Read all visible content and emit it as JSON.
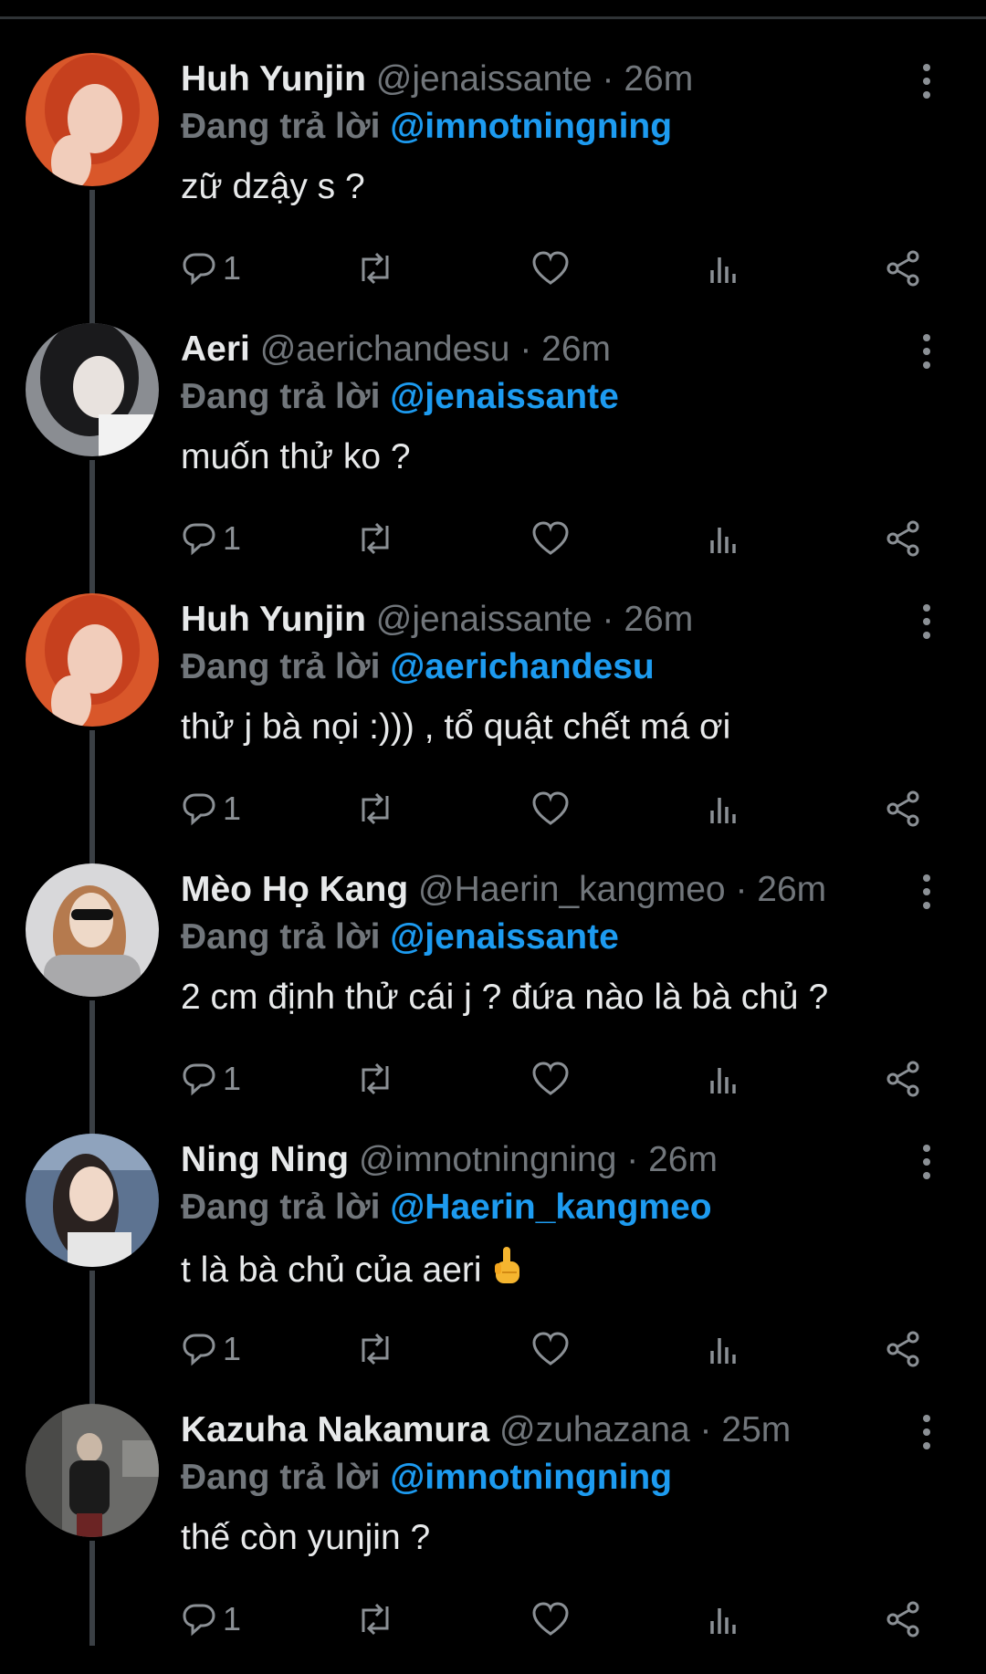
{
  "reply_prefix": "Đang trả lời",
  "tweets": [
    {
      "name": "Huh Yunjin",
      "handle": "@jenaissante · 26m",
      "reply_to": "@imnotningning",
      "text": "zữ dzậy s ?",
      "replies": "1",
      "avatar": {
        "bg": "#d9572a",
        "skin": "#f1cdbb",
        "hair": "#c6401e"
      }
    },
    {
      "name": "Aeri",
      "handle": "@aerichandesu · 26m",
      "reply_to": "@jenaissante",
      "text": "muốn thử ko ?",
      "replies": "1",
      "avatar": {
        "bg": "#8a8d92",
        "skin": "#e8e2de",
        "hair": "#1a1a1c"
      }
    },
    {
      "name": "Huh Yunjin",
      "handle": "@jenaissante · 26m",
      "reply_to": "@aerichandesu",
      "text": "thử j bà nọi :))) , tổ quật chết má ơi",
      "replies": "1",
      "avatar": {
        "bg": "#d9572a",
        "skin": "#f1cdbb",
        "hair": "#c6401e"
      }
    },
    {
      "name": "Mèo Họ Kang",
      "handle": "@Haerin_kangmeo · 26m",
      "reply_to": "@jenaissante",
      "text": "2 cm định thử cái j ? đứa nào là bà chủ ?",
      "replies": "1",
      "avatar": {
        "bg": "#d8d8da",
        "skin": "#eed9c8",
        "hair": "#b57a4e"
      }
    },
    {
      "name": "Ning Ning",
      "handle": "@imnotningning · 26m",
      "reply_to": "@Haerin_kangmeo",
      "text": "t là bà chủ của aeri",
      "replies": "1",
      "emoji": "middle-finger",
      "avatar": {
        "bg": "#5d7391",
        "skin": "#f0d8c8",
        "hair": "#2a2220"
      }
    },
    {
      "name": "Kazuha Nakamura",
      "handle": "@zuhazana · 25m",
      "reply_to": "@imnotningning",
      "text": "thế còn yunjin ?",
      "replies": "1",
      "avatar": {
        "bg": "#6a6a68",
        "skin": "#c9b7a6",
        "hair": "#1b1b1b"
      }
    }
  ],
  "icons": [
    "reply-icon",
    "retweet-icon",
    "like-icon",
    "views-icon",
    "share-icon",
    "more-icon"
  ],
  "colors": {
    "background": "#000000",
    "text": "#e7e9ea",
    "secondary": "#71767b",
    "link": "#1d9bf0",
    "thread_line": "#3a3f44"
  }
}
